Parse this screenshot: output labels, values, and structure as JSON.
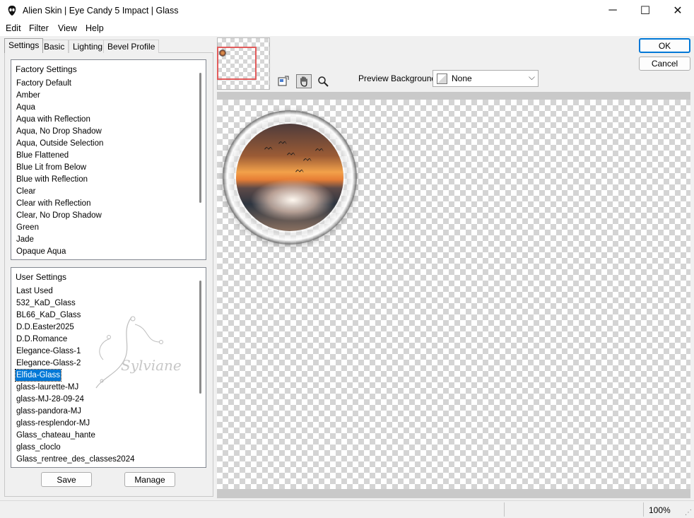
{
  "window": {
    "title": "Alien Skin | Eye Candy 5 Impact | Glass",
    "minimize": "─",
    "maximize": "☐",
    "close": "✕"
  },
  "menu": [
    {
      "label": "Edit"
    },
    {
      "label": "Filter"
    },
    {
      "label": "View"
    },
    {
      "label": "Help"
    }
  ],
  "tabs": [
    {
      "label": "Settings",
      "active": true
    },
    {
      "label": "Basic"
    },
    {
      "label": "Lighting"
    },
    {
      "label": "Bevel Profile"
    }
  ],
  "factory_settings": {
    "header": "Factory Settings",
    "items": [
      "Factory Default",
      "Amber",
      "Aqua",
      "Aqua with Reflection",
      "Aqua, No Drop Shadow",
      "Aqua, Outside Selection",
      "Blue Flattened",
      "Blue Lit from Below",
      "Blue with Reflection",
      "Clear",
      "Clear with Reflection",
      "Clear, No Drop Shadow",
      "Green",
      "Jade",
      "Opaque Aqua"
    ]
  },
  "user_settings": {
    "header": "User Settings",
    "items": [
      "Last Used",
      "532_KaD_Glass",
      "BL66_KaD_Glass",
      "D.D.Easter2025",
      "D.D.Romance",
      "Elegance-Glass-1",
      "Elegance-Glass-2",
      "Elfida-Glass",
      "glass-laurette-MJ",
      "glass-MJ-28-09-24",
      "glass-pandora-MJ",
      "glass-resplendor-MJ",
      "Glass_chateau_hante",
      "glass_cloclo",
      "Glass_rentree_des_classes2024"
    ],
    "selected": "Elfida-Glass",
    "watermark_text": "Sylviane"
  },
  "buttons": {
    "save": "Save",
    "manage": "Manage",
    "ok": "OK",
    "cancel": "Cancel"
  },
  "toolbar": {
    "tools": [
      "navigator-icon",
      "hand-icon",
      "zoom-icon"
    ],
    "active_tool": "hand-icon"
  },
  "preview_background": {
    "label": "Preview Background:",
    "value": "None"
  },
  "status": {
    "zoom": "100%"
  },
  "colors": {
    "accent": "#0078d7",
    "nav_rect": "#e25c5c"
  }
}
